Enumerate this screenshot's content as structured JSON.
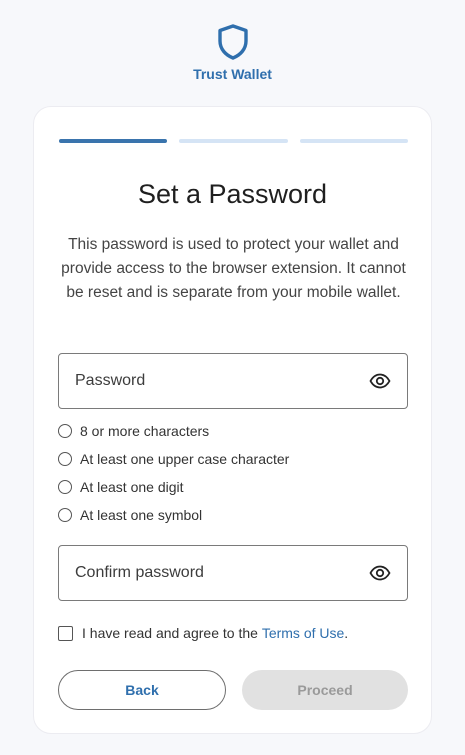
{
  "brand": {
    "name": "Trust Wallet",
    "icon": "shield-icon",
    "color": "#2f6fad"
  },
  "progress": {
    "steps": 3,
    "current": 1
  },
  "title": "Set a Password",
  "description": "This password is used to protect your wallet and provide access to the browser extension. It cannot be reset and is separate from your mobile wallet.",
  "password": {
    "placeholder": "Password",
    "value": ""
  },
  "requirements": [
    {
      "label": "8 or more characters",
      "met": false
    },
    {
      "label": "At least one upper case character",
      "met": false
    },
    {
      "label": "At least one digit",
      "met": false
    },
    {
      "label": "At least one symbol",
      "met": false
    }
  ],
  "confirm": {
    "placeholder": "Confirm password",
    "value": ""
  },
  "agreement": {
    "prefix": "I have read and agree to the ",
    "link": "Terms of Use",
    "suffix": ".",
    "checked": false
  },
  "buttons": {
    "back": "Back",
    "proceed": "Proceed",
    "proceed_enabled": false
  }
}
